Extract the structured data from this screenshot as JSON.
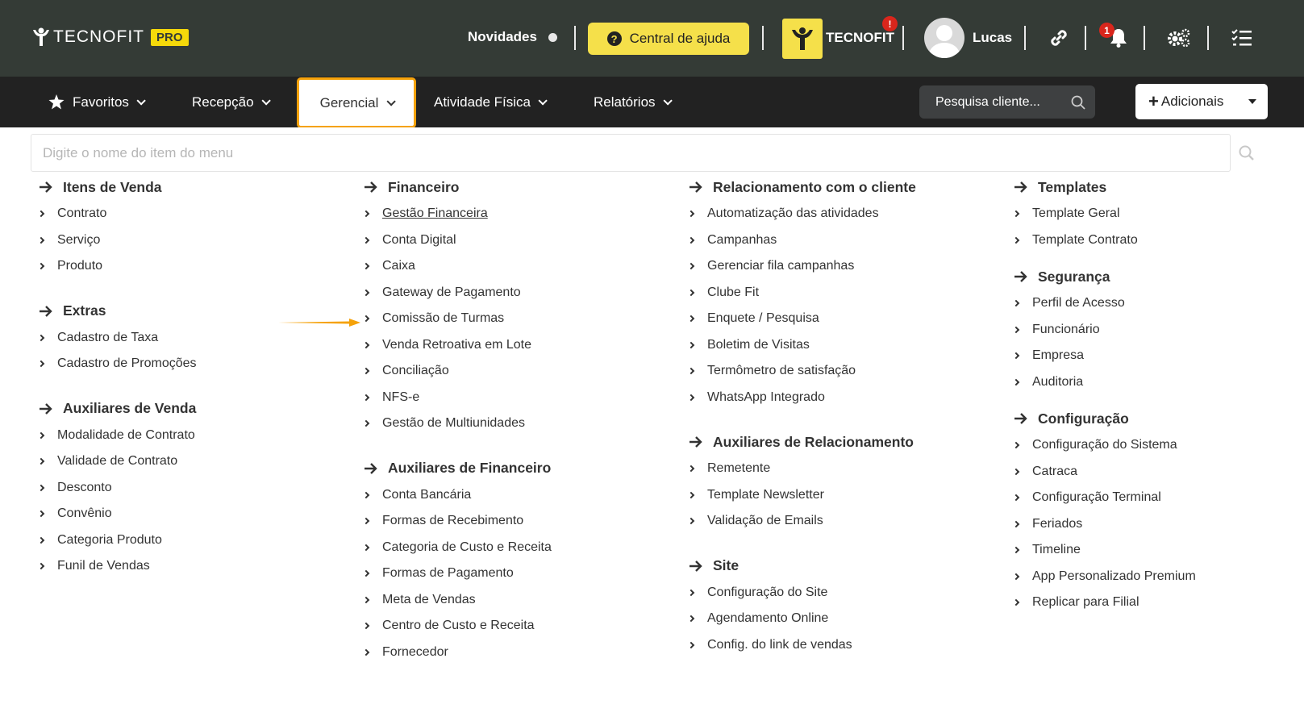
{
  "header": {
    "logo_text": "TECNOFIT",
    "logo_badge": "PRO",
    "novidades": "Novidades",
    "help_button": "Central de ajuda",
    "brand_name": "TECNOFIT",
    "brand_alert": "!",
    "user_name": "Lucas",
    "notification_count": "1"
  },
  "nav": {
    "favoritos": "Favoritos",
    "recepcao": "Recepção",
    "gerencial": "Gerencial",
    "atividade": "Atividade Física",
    "relatorios": "Relatórios",
    "client_search_placeholder": "Pesquisa cliente...",
    "adicionais": "Adicionais"
  },
  "menu": {
    "search_placeholder": "Digite o nome do item do menu",
    "columns": [
      {
        "sections": [
          {
            "title": "Itens de Venda",
            "items": [
              "Contrato",
              "Serviço",
              "Produto"
            ]
          },
          {
            "title": "Extras",
            "items": [
              "Cadastro de Taxa",
              "Cadastro de Promoções"
            ]
          },
          {
            "title": "Auxiliares de Venda",
            "items": [
              "Modalidade de Contrato",
              "Validade de Contrato",
              "Desconto",
              "Convênio",
              "Categoria Produto",
              "Funil de Vendas"
            ]
          }
        ]
      },
      {
        "sections": [
          {
            "title": "Financeiro",
            "items": [
              "Gestão Financeira",
              "Conta Digital",
              "Caixa",
              "Gateway de Pagamento",
              "Comissão de Turmas",
              "Venda Retroativa em Lote",
              "Conciliação",
              "NFS-e",
              "Gestão de Multiunidades"
            ]
          },
          {
            "title": "Auxiliares de Financeiro",
            "items": [
              "Conta Bancária",
              "Formas de Recebimento",
              "Categoria de Custo e Receita",
              "Formas de Pagamento",
              "Meta de Vendas",
              "Centro de Custo e Receita",
              "Fornecedor"
            ]
          }
        ]
      },
      {
        "sections": [
          {
            "title": "Relacionamento com o cliente",
            "items": [
              "Automatização das atividades",
              "Campanhas",
              "Gerenciar fila campanhas",
              "Clube Fit",
              "Enquete / Pesquisa",
              "Boletim de Visitas",
              "Termômetro de satisfação",
              "WhatsApp Integrado"
            ]
          },
          {
            "title": "Auxiliares de Relacionamento",
            "items": [
              "Remetente",
              "Template Newsletter",
              "Validação de Emails"
            ]
          },
          {
            "title": "Site",
            "items": [
              "Configuração do Site",
              "Agendamento Online",
              "Config. do link de vendas"
            ]
          }
        ]
      },
      {
        "sections": [
          {
            "title": "Templates",
            "items": [
              "Template Geral",
              "Template Contrato"
            ]
          },
          {
            "title": "Segurança",
            "items": [
              "Perfil de Acesso",
              "Funcionário",
              "Empresa",
              "Auditoria"
            ]
          },
          {
            "title": "Configuração",
            "items": [
              "Configuração do Sistema",
              "Catraca",
              "Configuração Terminal",
              "Feriados",
              "Timeline",
              "App Personalizado Premium",
              "Replicar para Filial"
            ]
          }
        ]
      }
    ]
  },
  "colors": {
    "topbar": "#343b36",
    "navbar": "#222222",
    "accent_yellow": "#f5e04a",
    "active_border": "#f5a20a",
    "badge_red": "#d9261c"
  }
}
